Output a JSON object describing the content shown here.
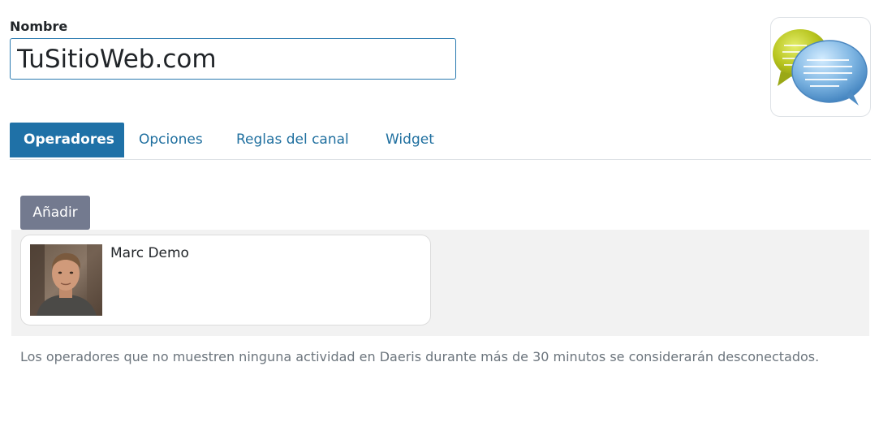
{
  "form": {
    "name_label": "Nombre",
    "name_value": "TuSitioWeb.com",
    "image_icon": "chat-bubbles-icon"
  },
  "tabs": [
    {
      "label": "Operadores",
      "active": true
    },
    {
      "label": "Opciones",
      "active": false
    },
    {
      "label": "Reglas del canal",
      "active": false
    },
    {
      "label": "Widget",
      "active": false
    }
  ],
  "operators": {
    "add_label": "Añadir",
    "items": [
      {
        "name": "Marc Demo",
        "avatar": "user-photo"
      }
    ],
    "help_text": "Los operadores que no muestren ninguna actividad en Daeris durante más de 30 minutos se considerarán desconectados."
  },
  "colors": {
    "accent": "#1f71a7",
    "link": "#1f6f9f",
    "button": "#737a8f",
    "muted_text": "#6c757d"
  }
}
